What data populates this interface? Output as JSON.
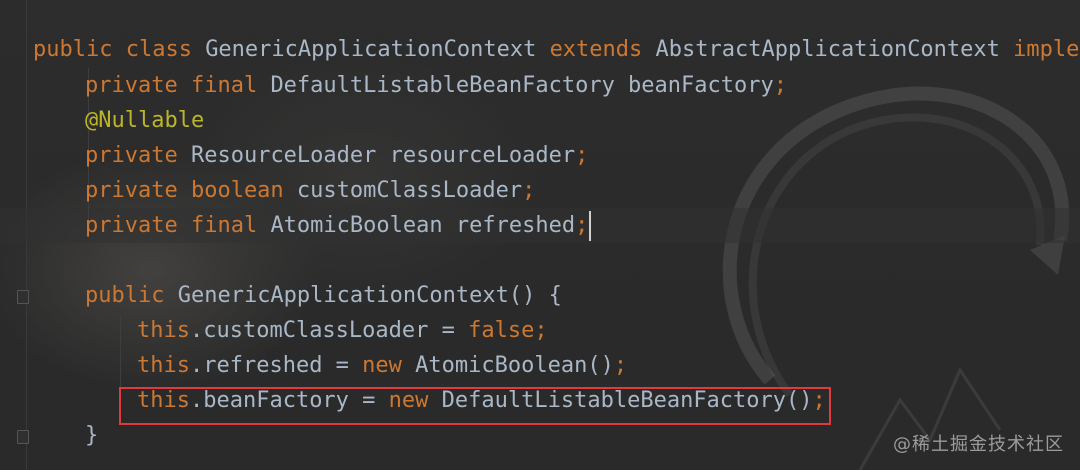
{
  "editor": {
    "lines": [
      {
        "id": "line-class-decl",
        "tokens": [
          {
            "t": "public class ",
            "c": "kw"
          },
          {
            "t": "GenericApplicationContext ",
            "c": "plain"
          },
          {
            "t": "extends ",
            "c": "kw"
          },
          {
            "t": "AbstractApplicationContext ",
            "c": "plain"
          },
          {
            "t": "impleme",
            "c": "kw"
          }
        ]
      },
      {
        "id": "line-field-beanfactory",
        "tokens": [
          {
            "t": "private final ",
            "c": "kw"
          },
          {
            "t": "DefaultListableBeanFactory beanFactory",
            "c": "plain"
          },
          {
            "t": ";",
            "c": "kw"
          }
        ]
      },
      {
        "id": "line-annotation-nullable",
        "tokens": [
          {
            "t": "@Nullable",
            "c": "ann"
          }
        ]
      },
      {
        "id": "line-field-resourceloader",
        "tokens": [
          {
            "t": "private ",
            "c": "kw"
          },
          {
            "t": "ResourceLoader resourceLoader",
            "c": "plain"
          },
          {
            "t": ";",
            "c": "kw"
          }
        ]
      },
      {
        "id": "line-field-customclassloader",
        "tokens": [
          {
            "t": "private boolean ",
            "c": "kw"
          },
          {
            "t": "customClassLoader",
            "c": "plain"
          },
          {
            "t": ";",
            "c": "kw"
          }
        ]
      },
      {
        "id": "line-field-refreshed",
        "tokens": [
          {
            "t": "private final ",
            "c": "kw"
          },
          {
            "t": "AtomicBoolean refreshed",
            "c": "plain"
          },
          {
            "t": ";",
            "c": "kw"
          }
        ]
      },
      {
        "id": "line-blank",
        "tokens": []
      },
      {
        "id": "line-constructor-decl",
        "tokens": [
          {
            "t": "public ",
            "c": "kw"
          },
          {
            "t": "GenericApplicationContext() {",
            "c": "plain"
          }
        ]
      },
      {
        "id": "line-assign-customclassloader",
        "tokens": [
          {
            "t": "this",
            "c": "kw"
          },
          {
            "t": ".customClassLoader = ",
            "c": "plain"
          },
          {
            "t": "false",
            "c": "kw"
          },
          {
            "t": ";",
            "c": "kw"
          }
        ]
      },
      {
        "id": "line-assign-refreshed",
        "tokens": [
          {
            "t": "this",
            "c": "kw"
          },
          {
            "t": ".refreshed = ",
            "c": "plain"
          },
          {
            "t": "new ",
            "c": "kw"
          },
          {
            "t": "AtomicBoolean()",
            "c": "plain"
          },
          {
            "t": ";",
            "c": "kw"
          }
        ]
      },
      {
        "id": "line-assign-beanfactory",
        "tokens": [
          {
            "t": "this",
            "c": "kw"
          },
          {
            "t": ".beanFactory = ",
            "c": "plain"
          },
          {
            "t": "new ",
            "c": "kw"
          },
          {
            "t": "DefaultListableBeanFactory()",
            "c": "plain"
          },
          {
            "t": ";",
            "c": "kw"
          }
        ]
      },
      {
        "id": "line-close-brace",
        "tokens": [
          {
            "t": "}",
            "c": "plain"
          }
        ]
      }
    ]
  },
  "watermark": "@稀土掘金技术社区",
  "colors": {
    "background": "#2b2b2b",
    "keyword": "#cc7832",
    "text": "#a9b7c6",
    "annotation": "#bbb529",
    "highlight_border": "#e0393e"
  }
}
